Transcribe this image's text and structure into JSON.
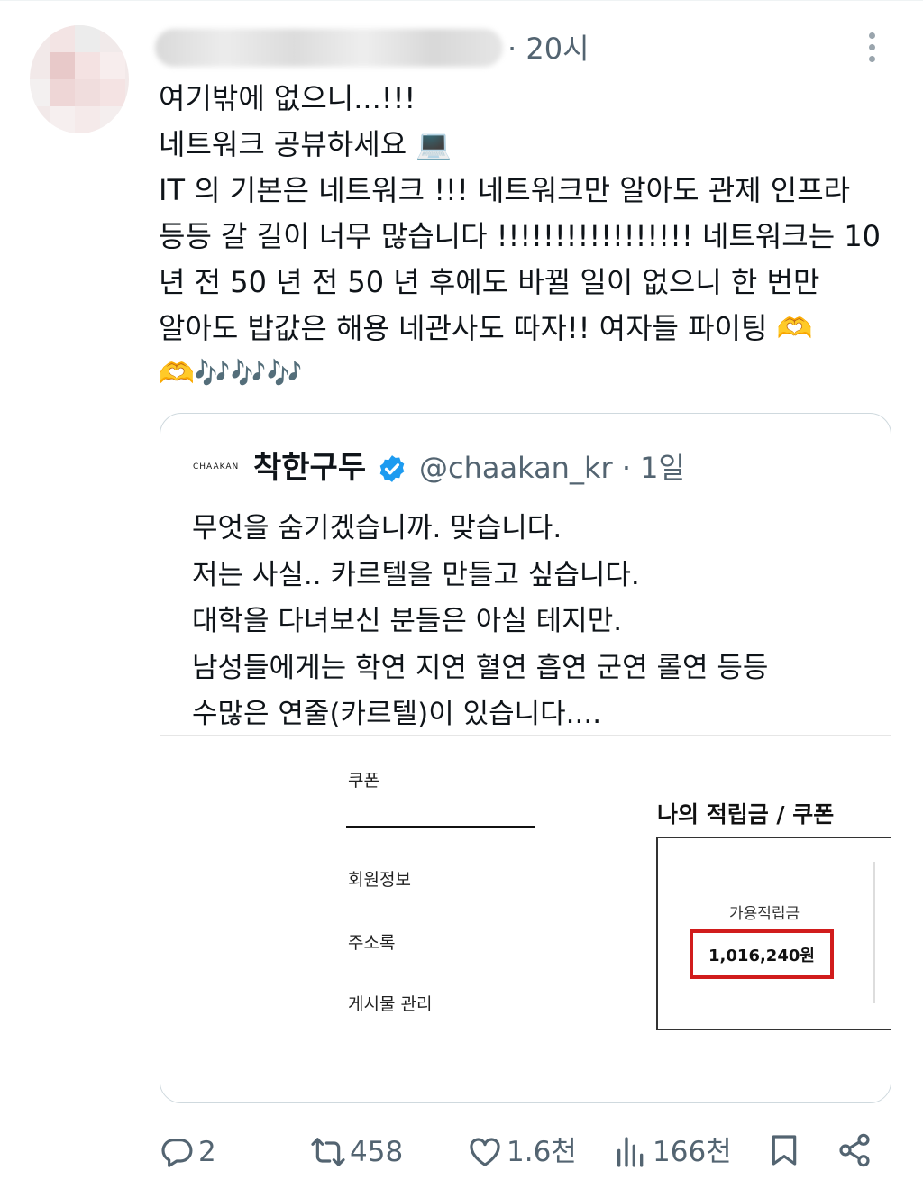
{
  "post": {
    "time": "· 20시",
    "lines": [
      "여기밖에 없으니...!!!",
      "네트워크 공뷰하세요 💻",
      "IT 의 기본은 네트워크 !!! 네트워크만 알아도 관제 인프라",
      "등등 갈 길이 너무 많습니다 !!!!!!!!!!!!!!!!! 네트워크는 10",
      "년 전 50 년 전 50 년 후에도 바뀔 일이 없으니 한 번만",
      "알아도 밥값은 해용 네관사도 따자!! 여자들 파이팅 🫶"
    ],
    "emoji_tail": "🫶🎶🎶🎶"
  },
  "quote": {
    "logo": "CHAAKAN",
    "name": "착한구두",
    "handle": "@chaakan_kr · 1일",
    "lines": [
      "무엇을 숨기겠습니까. 맞습니다.",
      "저는 사실.. 카르텔을 만들고 싶습니다.",
      "대학을 다녀보신 분들은 아실 테지만.",
      "남성들에게는 학연 지연 혈연 흡연 군연 롤연 등등",
      "수많은 연줄(카르텔)이 있습니다...."
    ],
    "media": {
      "menu": [
        "쿠폰",
        "회원정보",
        "주소록",
        "게시물 관리"
      ],
      "title": "나의 적립금 / 쿠폰",
      "label": "가용적립금",
      "amount": "1,016,240원"
    }
  },
  "actions": {
    "replies": "2",
    "reposts": "458",
    "likes": "1.6천",
    "views": "166천"
  },
  "colors": {
    "text": "#0f1419",
    "secondary": "#536471",
    "verified": "#1d9bf0",
    "highlight": "#d11c1c"
  },
  "icons": [
    "reply-icon",
    "repost-icon",
    "like-icon",
    "views-icon",
    "bookmark-icon",
    "share-icon",
    "verified-badge-icon",
    "more-icon"
  ]
}
